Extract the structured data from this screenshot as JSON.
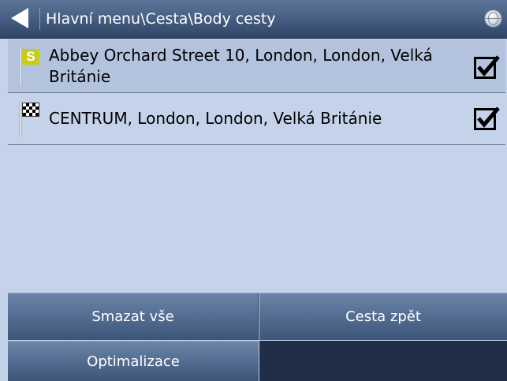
{
  "header": {
    "title": "Hlavní menu\\Cesta\\Body cesty",
    "back_icon": "back-arrow-icon",
    "globe_icon": "globe-icon"
  },
  "waypoints": [
    {
      "label": "Abbey Orchard Street 10, London, London, Velká Británie",
      "icon": "start-flag-icon",
      "icon_letter": "S",
      "checked": true,
      "selected": true
    },
    {
      "label": "CENTRUM, London, London, Velká Británie",
      "icon": "finish-flag-icon",
      "checked": true,
      "selected": false
    }
  ],
  "buttons": {
    "delete_all": "Smazat vše",
    "route_back": "Cesta zpět",
    "optimize": "Optimalizace"
  },
  "colors": {
    "list_background": "#c5d3ea",
    "header_background": "#2f4668",
    "button_background": "#3c5578",
    "start_flag": "#c7cc1a"
  }
}
